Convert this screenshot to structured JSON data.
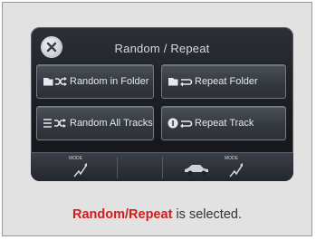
{
  "screen": {
    "title": "Random / Repeat",
    "close_icon": "close-icon",
    "options": [
      {
        "label": "Random in Folder",
        "icon": "random-folder-icon"
      },
      {
        "label": "Repeat Folder",
        "icon": "repeat-folder-icon"
      },
      {
        "label": "Random All Tracks",
        "icon": "random-all-icon"
      },
      {
        "label": "Repeat Track",
        "icon": "repeat-track-icon"
      }
    ],
    "bottom_bar": {
      "mode_label": "MODE",
      "icons": [
        "mode-left-icon",
        "car-icon",
        "mode-right-icon"
      ]
    }
  },
  "caption": {
    "highlight": "Random/Repeat",
    "rest": "is selected."
  },
  "colors": {
    "highlight": "#d01c1c",
    "screen_bg": "#1a1d21",
    "panel_bg": "#e2e2e2"
  }
}
